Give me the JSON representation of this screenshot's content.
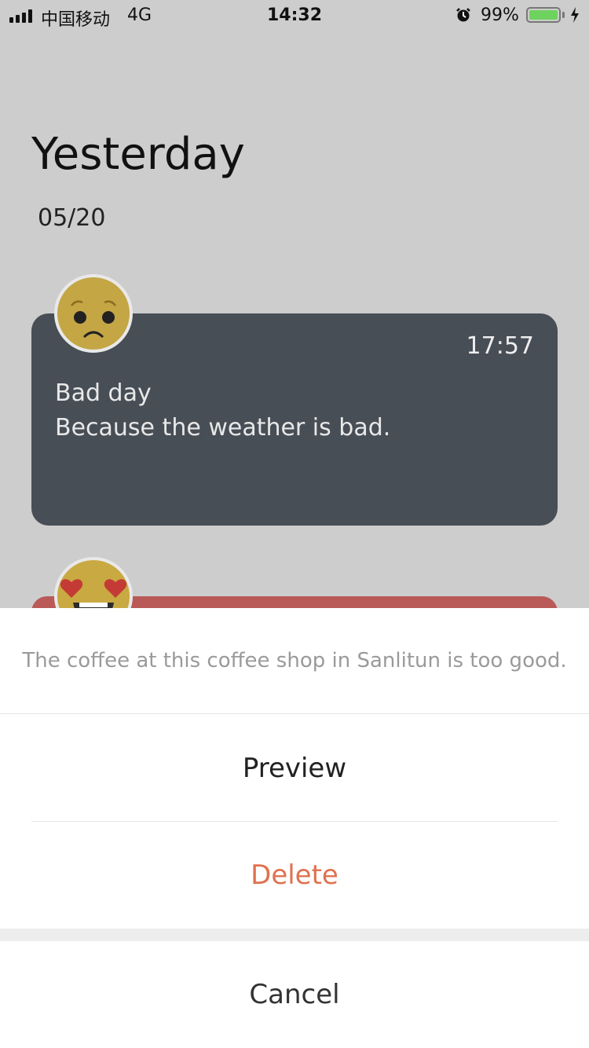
{
  "status_bar": {
    "carrier": "中国移动",
    "network": "4G",
    "time": "14:32",
    "battery_percent_label": "99%",
    "battery_level": 0.99,
    "icons": [
      "signal-icon",
      "alarm-icon",
      "battery-icon",
      "charging-icon"
    ]
  },
  "page": {
    "title": "Yesterday",
    "date": "05/20"
  },
  "entries": [
    {
      "mood_icon": "sad-face-emoji",
      "time": "17:57",
      "title": "Bad day",
      "text": "Because the weather is bad.",
      "card_color": "#484e56"
    },
    {
      "mood_icon": "heart-eyes-emoji",
      "card_color": "#b95a58"
    }
  ],
  "action_sheet": {
    "message": "The coffee at this coffee shop in Sanlitun is too good.",
    "preview_label": "Preview",
    "delete_label": "Delete",
    "cancel_label": "Cancel",
    "delete_color": "#e0714f"
  }
}
